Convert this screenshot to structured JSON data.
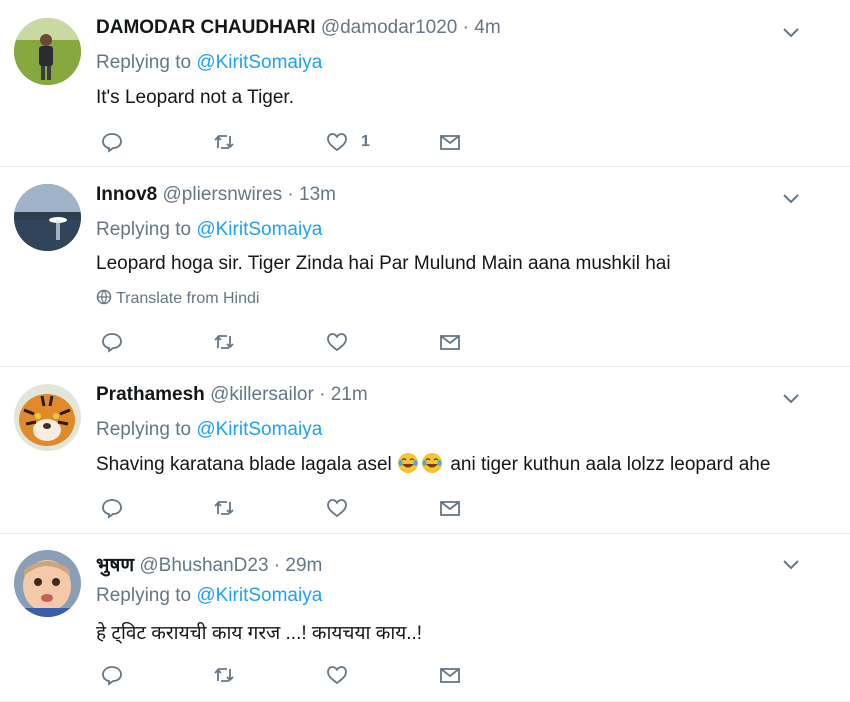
{
  "tweets": [
    {
      "name": "DAMODAR CHAUDHARI",
      "handle": "@damodar1020",
      "time": "4m",
      "replying_label": "Replying to",
      "mention": "@KiritSomaiya",
      "text": "It's Leopard not a Tiger.",
      "like_count": "1",
      "avatar_desc": "man-in-field"
    },
    {
      "name": "Innov8",
      "handle": "@pliersnwires",
      "time": "13m",
      "replying_label": "Replying to",
      "mention": "@KiritSomaiya",
      "text": "Leopard hoga sir. Tiger Zinda hai Par Mulund Main aana mushkil hai",
      "translate": "Translate from Hindi",
      "like_count": "",
      "avatar_desc": "sunset-lake"
    },
    {
      "name": "Prathamesh",
      "handle": "@killersailor",
      "time": "21m",
      "replying_label": "Replying to",
      "mention": "@KiritSomaiya",
      "text_before": "Shaving karatana blade lagala asel",
      "text_after": "ani tiger kuthun aala lolzz leopard ahe",
      "like_count": "",
      "avatar_desc": "tiger-face"
    },
    {
      "name": "भुषण",
      "handle": "@BhushanD23",
      "time": "29m",
      "replying_label": "Replying to",
      "mention": "@KiritSomaiya",
      "text": "हे ट्विट करायची काय गरज ...! कायचया काय..!",
      "like_count": "",
      "avatar_desc": "baby"
    }
  ],
  "separator": "·",
  "colors": {
    "link": "#1da1f2",
    "secondary_text": "#657786",
    "primary_text": "#14171a",
    "divider": "#e6ecf0"
  },
  "icons": [
    "reply-icon",
    "retweet-icon",
    "like-icon",
    "dm-icon",
    "chevron-down-icon",
    "globe-icon"
  ]
}
